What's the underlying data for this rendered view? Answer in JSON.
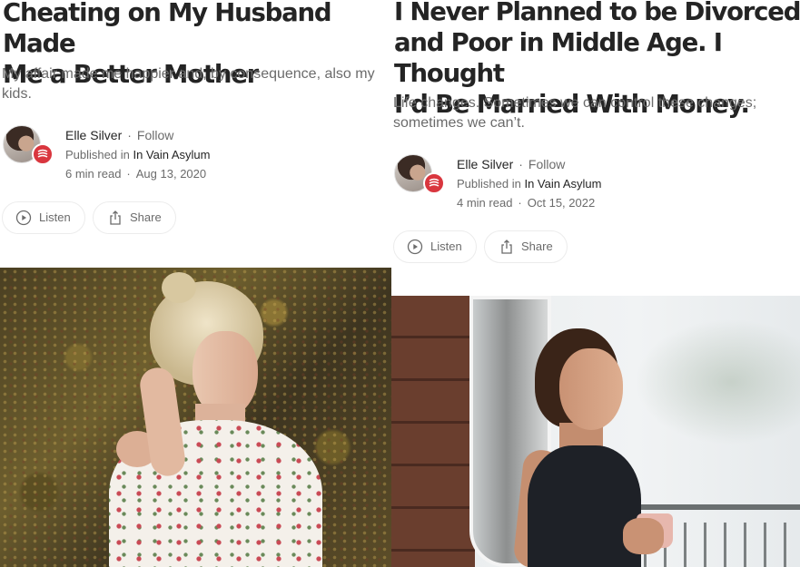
{
  "articles": [
    {
      "title": "Cheating on My Husband Made\nMe a Better Mother",
      "subtitle": "My affair made me happier and, by consequence, also my kids.",
      "author": "Elle Silver",
      "follow_label": "Follow",
      "published_in_label": "Published in",
      "publication": "In Vain Asylum",
      "read_time": "6 min read",
      "date": "Aug 13, 2020",
      "listen_label": "Listen",
      "share_label": "Share"
    },
    {
      "title": "I Never Planned to be Divorced\nand Poor in Middle Age. I Thought\nI’d Be Married With Money.",
      "subtitle": "Life changes. Sometimes we can control these changes; sometimes we can’t.",
      "author": "Elle Silver",
      "follow_label": "Follow",
      "published_in_label": "Published in",
      "publication": "In Vain Asylum",
      "read_time": "4 min read",
      "date": "Oct 15, 2022",
      "listen_label": "Listen",
      "share_label": "Share"
    }
  ],
  "separator": "·",
  "icons": {
    "listen": "play-circle-icon",
    "share": "share-upload-icon",
    "publication_badge": "publication-logo-icon"
  },
  "colors": {
    "text_primary": "#242424",
    "text_secondary": "#6b6b6b",
    "badge_red": "#d9363e"
  }
}
